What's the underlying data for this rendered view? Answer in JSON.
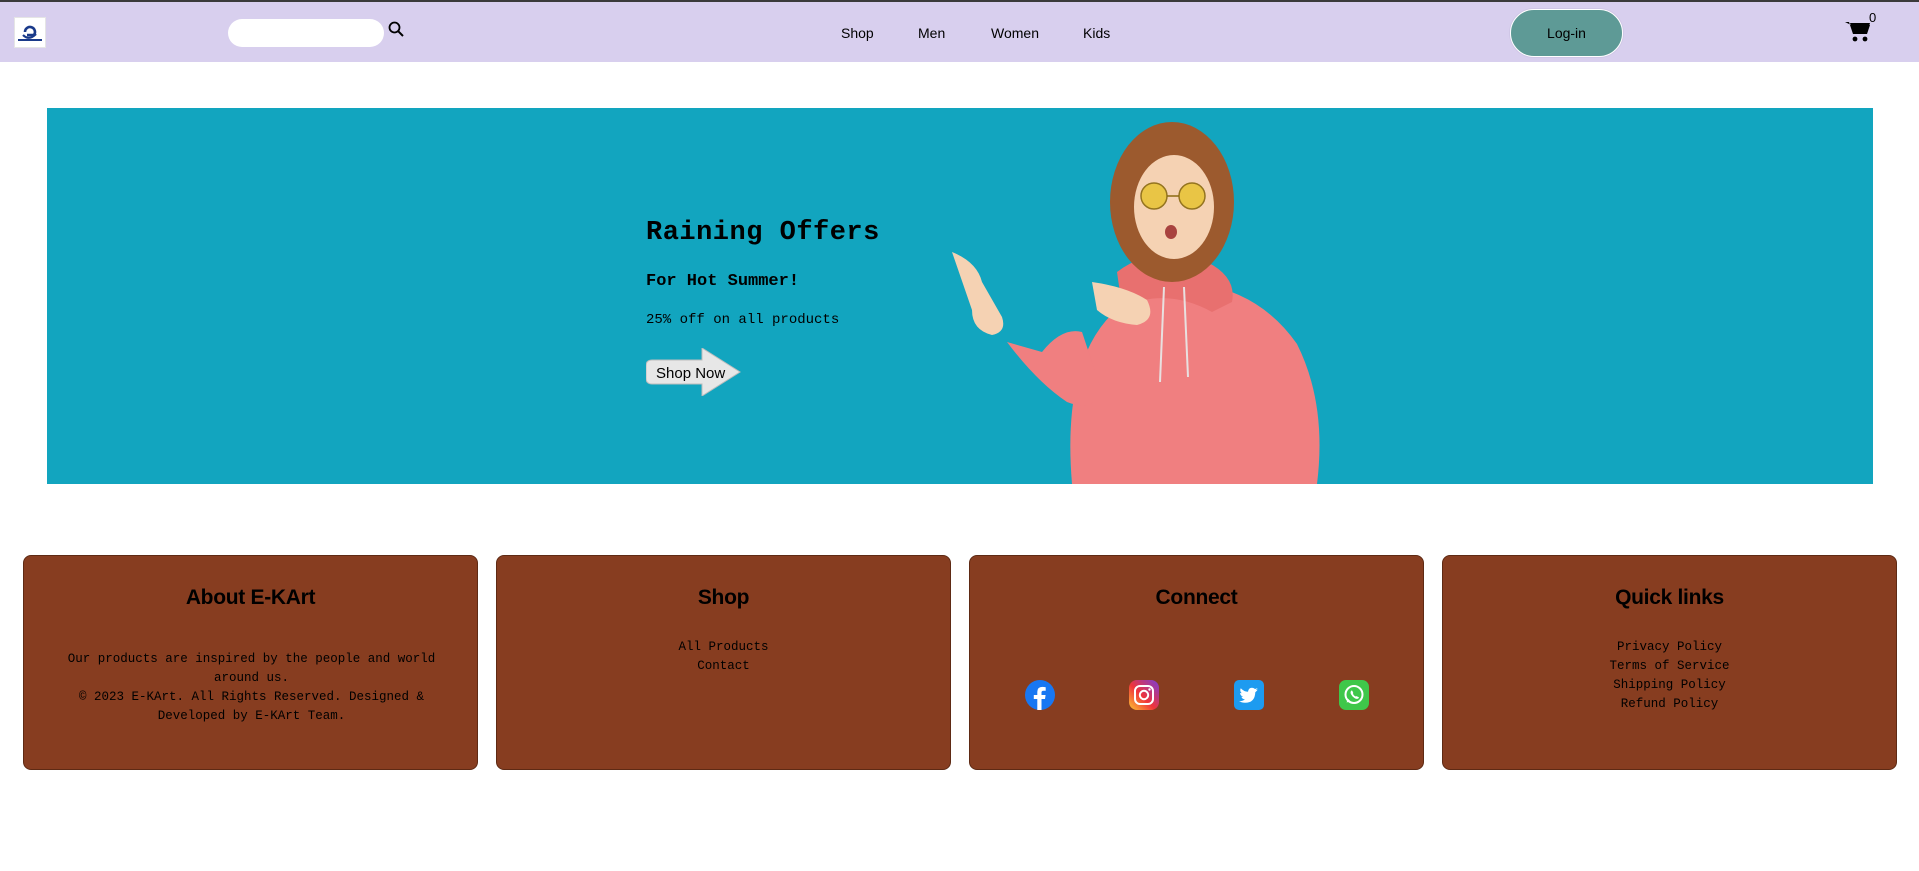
{
  "header": {
    "logo_alt": "E-KArt",
    "search": {
      "value": "",
      "placeholder": ""
    },
    "nav": [
      "Shop",
      "Men",
      "Women",
      "Kids"
    ],
    "login_label": "Log-in",
    "cart_count": "0"
  },
  "hero": {
    "title": "Raining Offers",
    "subtitle": "For Hot Summer!",
    "offer": "25% off on all products",
    "cta_label": "Shop Now",
    "background": "#12a5bf"
  },
  "footer": {
    "card_color": "#873d20",
    "about": {
      "title": "About E-KArt",
      "text": "Our products are inspired by the people and world around us.",
      "copyright": "© 2023 E-KArt. All Rights Reserved. Designed & Developed by E-KArt Team."
    },
    "shop": {
      "title": "Shop",
      "links": [
        "All Products",
        "Contact"
      ]
    },
    "connect": {
      "title": "Connect",
      "icons": [
        "facebook-icon",
        "instagram-icon",
        "twitter-icon",
        "whatsapp-icon"
      ]
    },
    "quick_links": {
      "title": "Quick links",
      "links": [
        "Privacy Policy",
        "Terms of Service",
        "Shipping Policy",
        "Refund Policy"
      ]
    }
  },
  "colors": {
    "navbar": "#d8cfee",
    "login_button": "#5e9a96"
  }
}
